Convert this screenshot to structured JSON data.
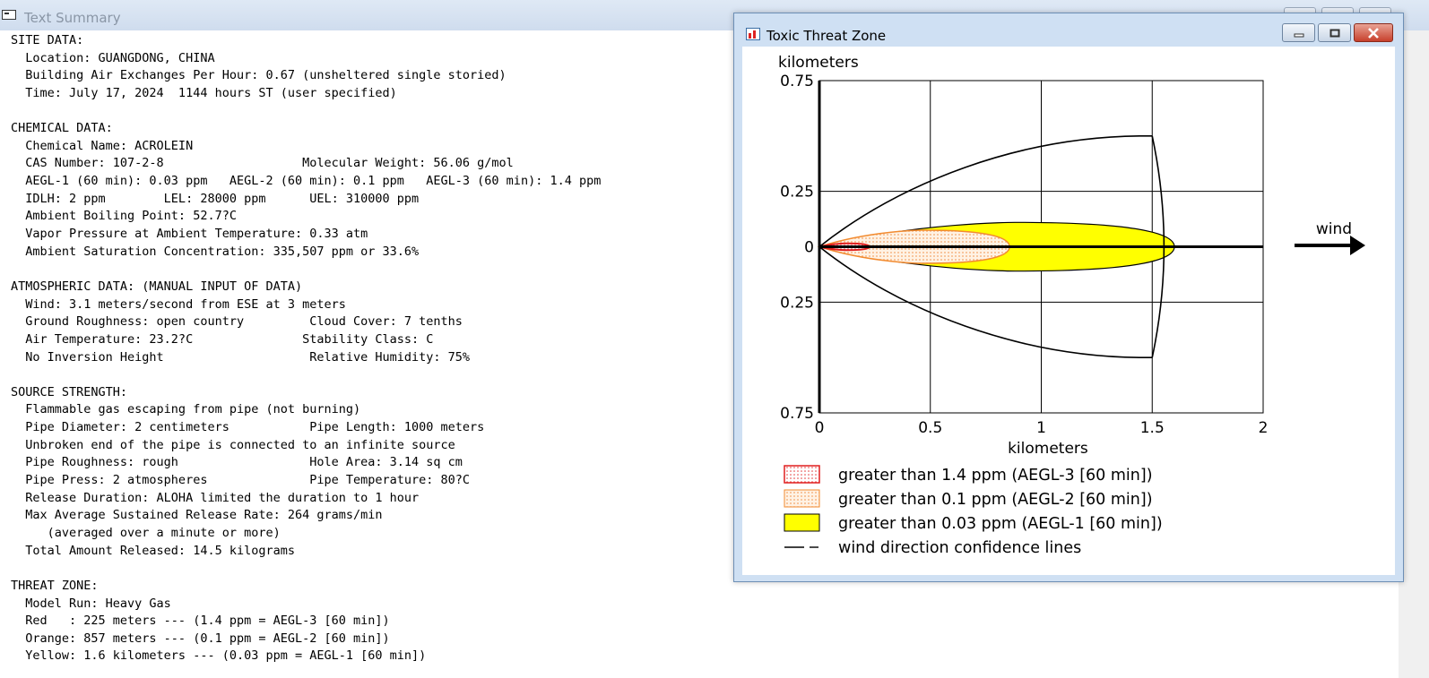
{
  "text_summary": {
    "title": "Text Summary",
    "lines": [
      "SITE DATA:",
      "  Location: GUANGDONG, CHINA",
      "  Building Air Exchanges Per Hour: 0.67 (unsheltered single storied)",
      "  Time: July 17, 2024  1144 hours ST (user specified)",
      "",
      "CHEMICAL DATA:",
      "  Chemical Name: ACROLEIN",
      "  CAS Number: 107-2-8                   Molecular Weight: 56.06 g/mol",
      "  AEGL-1 (60 min): 0.03 ppm   AEGL-2 (60 min): 0.1 ppm   AEGL-3 (60 min): 1.4 ppm",
      "  IDLH: 2 ppm        LEL: 28000 ppm      UEL: 310000 ppm",
      "  Ambient Boiling Point: 52.7?C",
      "  Vapor Pressure at Ambient Temperature: 0.33 atm",
      "  Ambient Saturation Concentration: 335,507 ppm or 33.6%",
      "",
      "ATMOSPHERIC DATA: (MANUAL INPUT OF DATA)",
      "  Wind: 3.1 meters/second from ESE at 3 meters",
      "  Ground Roughness: open country         Cloud Cover: 7 tenths",
      "  Air Temperature: 23.2?C               Stability Class: C",
      "  No Inversion Height                    Relative Humidity: 75%",
      "",
      "SOURCE STRENGTH:",
      "  Flammable gas escaping from pipe (not burning)",
      "  Pipe Diameter: 2 centimeters           Pipe Length: 1000 meters",
      "  Unbroken end of the pipe is connected to an infinite source",
      "  Pipe Roughness: rough                  Hole Area: 3.14 sq cm",
      "  Pipe Press: 2 atmospheres              Pipe Temperature: 80?C",
      "  Release Duration: ALOHA limited the duration to 1 hour",
      "  Max Average Sustained Release Rate: 264 grams/min",
      "     (averaged over a minute or more)",
      "  Total Amount Released: 14.5 kilograms",
      "",
      "THREAT ZONE:",
      "  Model Run: Heavy Gas",
      "  Red   : 225 meters --- (1.4 ppm = AEGL-3 [60 min])",
      "  Orange: 857 meters --- (0.1 ppm = AEGL-2 [60 min])",
      "  Yellow: 1.6 kilometers --- (0.03 ppm = AEGL-1 [60 min])"
    ]
  },
  "threat_window": {
    "title": "Toxic Threat Zone",
    "buttons": {
      "minimize": "minimize",
      "maximize": "maximize",
      "close": "close"
    },
    "wind_label": "wind",
    "legend": [
      {
        "label": "greater than 1.4 ppm (AEGL-3 [60 min])",
        "swatch": "red-dotted",
        "color": "#e53b3b"
      },
      {
        "label": "greater than 0.1 ppm (AEGL-2 [60 min])",
        "swatch": "orange-dotted",
        "color": "#f7a24c"
      },
      {
        "label": "greater than 0.03 ppm (AEGL-1 [60 min])",
        "swatch": "yellow-solid",
        "color": "#ffff00"
      },
      {
        "label": "wind direction confidence lines",
        "swatch": "dash-line",
        "color": "#000000"
      }
    ]
  },
  "chart_data": {
    "type": "area",
    "xlabel": "kilometers",
    "ylabel": "kilometers",
    "xlim": [
      0,
      2
    ],
    "ylim": [
      -0.75,
      0.75
    ],
    "x_ticks": [
      "0",
      "0.5",
      "1",
      "1.5",
      "2"
    ],
    "y_ticks": [
      "0.75",
      "0.25",
      "0",
      "0.25",
      "0.75"
    ],
    "y_tick_values": [
      0.75,
      0.25,
      0,
      -0.25,
      -0.75
    ],
    "grid": true,
    "legend_position": "bottom",
    "zones": [
      {
        "name": "greater than 0.03 ppm (AEGL-1 [60 min])",
        "downwind_extent_km": 1.6,
        "max_half_width_km": 0.11,
        "color": "#ffff00"
      },
      {
        "name": "greater than 0.1 ppm (AEGL-2 [60 min])",
        "downwind_extent_km": 0.857,
        "max_half_width_km": 0.075,
        "color": "#ffd9b0"
      },
      {
        "name": "greater than 1.4 ppm (AEGL-3 [60 min])",
        "downwind_extent_km": 0.225,
        "max_half_width_km": 0.015,
        "color": "#e53b3b"
      }
    ],
    "confidence_lines": {
      "name": "wind direction confidence lines",
      "end_x_km": 1.5,
      "half_width_at_end_km": 0.5,
      "arc_apex_x_km": 1.59
    }
  }
}
